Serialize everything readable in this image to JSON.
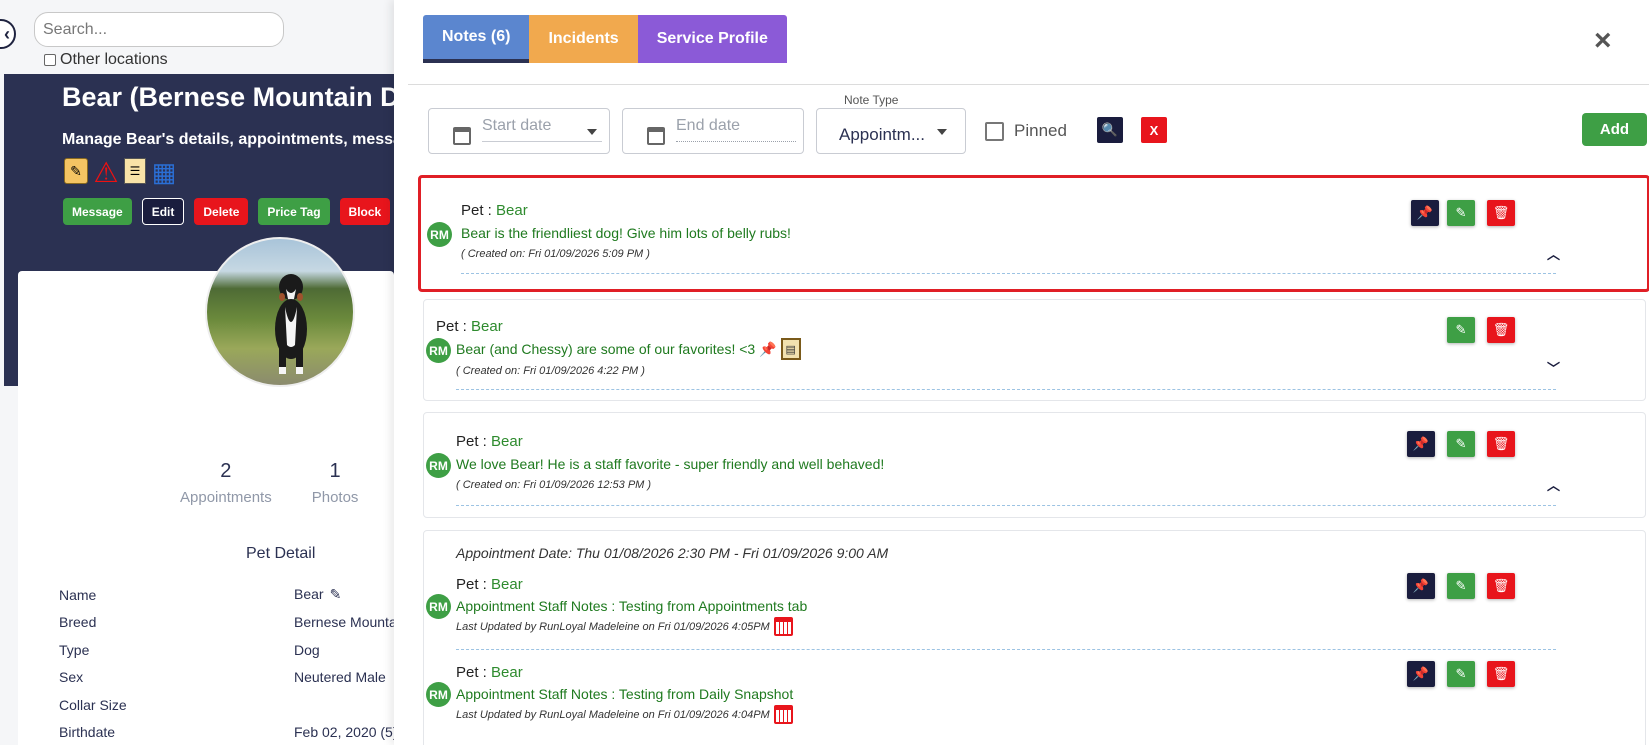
{
  "left": {
    "search_placeholder": "Search...",
    "other_locations_label": "Other locations",
    "pet_title": "Bear (Bernese Mountain Do",
    "pet_subtitle": "Manage Bear's details, appointments, messa",
    "quick_icons": [
      "note-icon",
      "warning-icon",
      "clipboard-icon",
      "qr-code-icon"
    ],
    "actions": {
      "message": "Message",
      "edit": "Edit",
      "delete": "Delete",
      "price_tag": "Price Tag",
      "block": "Block"
    },
    "stats": [
      {
        "value": "2",
        "label": "Appointments"
      },
      {
        "value": "1",
        "label": "Photos"
      }
    ],
    "detail_heading": "Pet Detail",
    "details": [
      {
        "key": "Name",
        "value": "Bear"
      },
      {
        "key": "Breed",
        "value": "Bernese Mounta"
      },
      {
        "key": "Type",
        "value": "Dog"
      },
      {
        "key": "Sex",
        "value": "Neutered Male"
      },
      {
        "key": "Collar Size",
        "value": ""
      },
      {
        "key": "Birthdate",
        "value": "Feb 02, 2020  (5)"
      }
    ]
  },
  "panel": {
    "tabs": {
      "notes": "Notes (6)",
      "incidents": "Incidents",
      "service_profile": "Service Profile"
    },
    "close": "×",
    "filters": {
      "start_date_placeholder": "Start date",
      "end_date_placeholder": "End date",
      "note_type_label": "Note Type",
      "note_type_value": "Appointm...",
      "pinned_label": "Pinned",
      "search_btn": "🔍",
      "clear_btn": "X",
      "add_btn": "Add"
    },
    "notes": [
      {
        "pet_label": "Pet :",
        "pet_name": "Bear",
        "initials": "RM",
        "text": "Bear is the friendliest dog! Give him lots of belly rubs!",
        "created": "( Created on: Fri 01/09/2026 5:09 PM )"
      },
      {
        "pet_label": "Pet :",
        "pet_name": "Bear",
        "initials": "RM",
        "text": "Bear (and Chessy) are some of our favorites! <3",
        "created": "( Created on: Fri 01/09/2026 4:22 PM )"
      },
      {
        "pet_label": "Pet :",
        "pet_name": "Bear",
        "initials": "RM",
        "text": "We love Bear! He is a staff favorite - super friendly and well behaved!",
        "created": "( Created on: Fri 01/09/2026 12:53 PM )"
      }
    ],
    "appointment": {
      "date": "Appointment Date: Thu 01/08/2026 2:30 PM - Fri 01/09/2026 9:00 AM",
      "entries": [
        {
          "pet_label": "Pet :",
          "pet_name": "Bear",
          "initials": "RM",
          "label": "Appointment Staff Notes :",
          "value": "Testing from Appointments tab",
          "updated": "Last Updated by RunLoyal Madeleine on Fri 01/09/2026 4:05PM"
        },
        {
          "pet_label": "Pet :",
          "pet_name": "Bear",
          "initials": "RM",
          "label": "Appointment Staff Notes :",
          "value": "Testing from Daily Snapshot",
          "updated": "Last Updated by RunLoyal Madeleine on Fri 01/09/2026 4:04PM"
        }
      ]
    }
  }
}
